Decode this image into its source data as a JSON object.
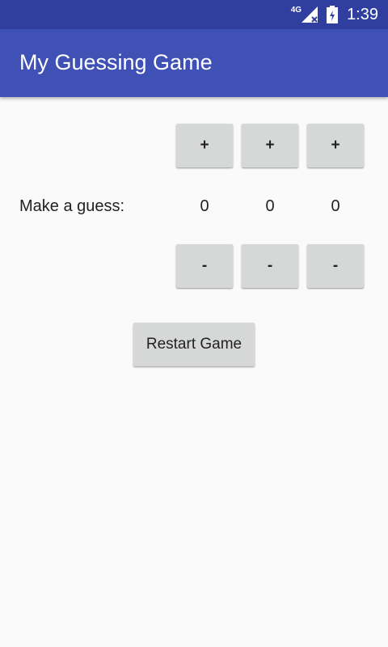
{
  "status_bar": {
    "network": "4G",
    "time": "1:39",
    "icons": [
      "signal-icon",
      "battery-icon"
    ]
  },
  "app_bar": {
    "title": "My Guessing Game"
  },
  "guess": {
    "label": "Make a guess:",
    "increment_label": "+",
    "decrement_label": "-",
    "digits": [
      "0",
      "0",
      "0"
    ]
  },
  "restart_button": {
    "label": "Restart Game"
  },
  "colors": {
    "status_bar": "#303f9f",
    "app_bar": "#3f51b5",
    "background": "#fafafa",
    "button": "#d6d7d7"
  }
}
